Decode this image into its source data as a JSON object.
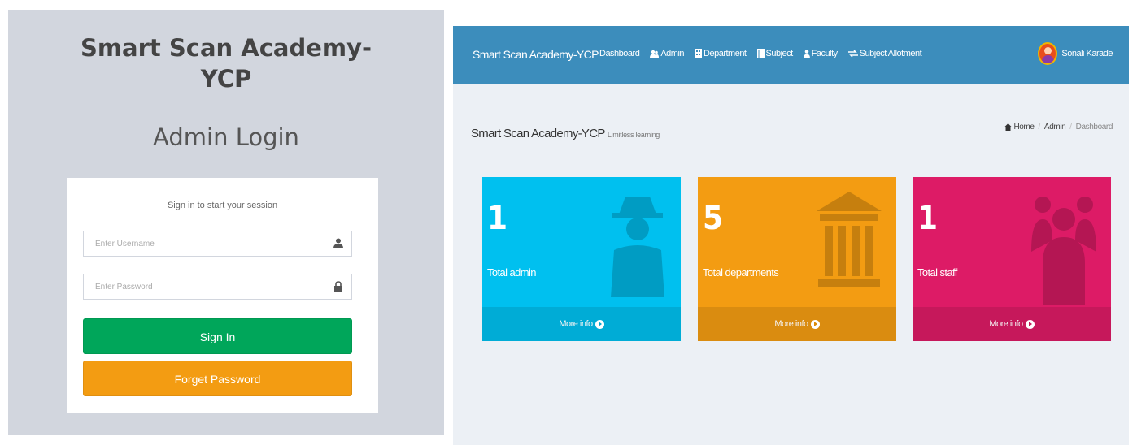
{
  "login": {
    "brand_line1": "Smart Scan Academy-",
    "brand_line2": "YCP",
    "subtitle": "Admin Login",
    "message": "Sign in to start your session",
    "username_placeholder": "Enter Username",
    "password_placeholder": "Enter Password",
    "username_icon": "user-icon",
    "password_icon": "lock-icon",
    "signin_label": "Sign In",
    "forget_label": "Forget Password",
    "colors": {
      "background": "#d2d6de",
      "signin": "#00a65a",
      "forget": "#f39c12"
    }
  },
  "dashboard": {
    "brand": "Smart Scan Academy-YCP",
    "nav": [
      {
        "label": "Dashboard",
        "icon": ""
      },
      {
        "label": "Admin",
        "icon": "users-icon"
      },
      {
        "label": "Department",
        "icon": "building-icon"
      },
      {
        "label": "Subject",
        "icon": "book-icon"
      },
      {
        "label": "Faculty",
        "icon": "user-icon"
      },
      {
        "label": "Subject Allotment",
        "icon": "exchange-icon"
      }
    ],
    "user_name": "Sonali Karade",
    "header_title": "Smart Scan Academy-YCP",
    "header_tagline": "Limitless learning",
    "breadcrumb": [
      "Home",
      "Admin",
      "Dashboard"
    ],
    "stats": [
      {
        "value": "1",
        "label": "Total admin",
        "footer": "More info",
        "color": "#00c0ef",
        "icon": "user-secret-icon"
      },
      {
        "value": "5",
        "label": "Total departments",
        "footer": "More info",
        "color": "#f39c12",
        "icon": "university-icon"
      },
      {
        "value": "1",
        "label": "Total staff",
        "footer": "More info",
        "color": "#dd1b66",
        "icon": "users-icon"
      }
    ],
    "colors": {
      "topbar": "#3c8dbc",
      "content_bg": "#ecf0f5"
    }
  }
}
